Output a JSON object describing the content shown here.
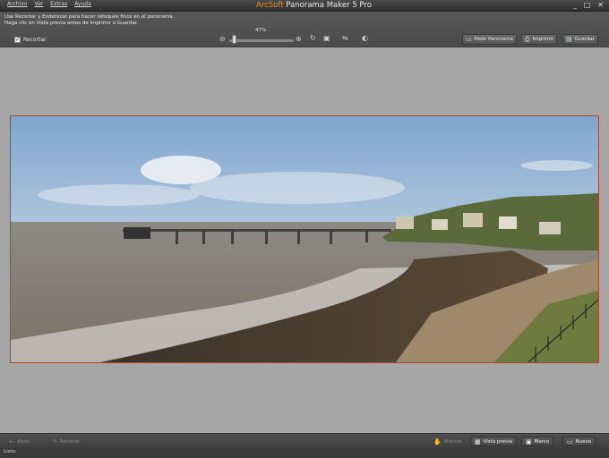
{
  "window": {
    "brand": "ArcSoft",
    "product": "Panorama Maker 5 Pro",
    "controls": [
      "_",
      "□",
      "✕"
    ]
  },
  "menu": [
    "Archivo",
    "Ver",
    "Extras",
    "Ayuda"
  ],
  "instructions": [
    "Use Recortar y Enderezar para hacer retoques finos en el panorama.",
    "Haga clic en Vista previa antes de Imprimir o Guardar."
  ],
  "toolbar": {
    "crop_label": "Recortar",
    "crop_checked": true,
    "zoom_label": "47%",
    "zoom_value": 0.05,
    "buttons": [
      {
        "label": "Pedir Panorama",
        "icon": "monitor-icon"
      },
      {
        "label": "Imprimir",
        "icon": "printer-icon"
      },
      {
        "label": "Guardar",
        "icon": "save-icon"
      }
    ]
  },
  "bottom": {
    "back": "Atrás",
    "redo": "Rehacer",
    "manual": "Manual",
    "preview": "Vista previa",
    "frame": "Marco",
    "new": "Nuevo"
  },
  "status": "Listo.",
  "colors": {
    "accent": "#f08a1c",
    "preview_border": "#b0442e"
  }
}
